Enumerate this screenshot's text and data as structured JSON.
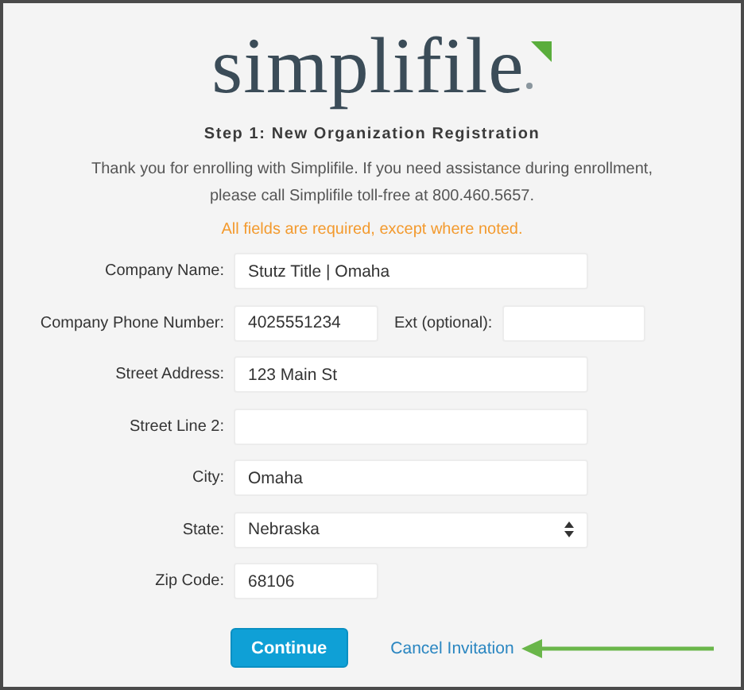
{
  "logo": {
    "text": "simplifile"
  },
  "heading": "Step 1: New Organization Registration",
  "intro": "Thank you for enrolling with Simplifile. If you need assistance during enrollment, please call Simplifile toll-free at 800.460.5657.",
  "notice": "All fields are required, except where noted.",
  "fields": [
    {
      "kind": "text",
      "label": "Company Name:",
      "value": "Stutz Title | Omaha"
    },
    {
      "kind": "short",
      "label": "Company Phone Number:",
      "value": "4025551234",
      "extra": {
        "label": "Ext (optional):"
      }
    },
    {
      "kind": "text",
      "label": "Street Address:",
      "value": "123 Main St"
    },
    {
      "kind": "text",
      "label": "Street Line 2:"
    },
    {
      "kind": "text",
      "label": "City:",
      "value": "Omaha"
    },
    {
      "kind": "select",
      "label": "State:",
      "value": "Nebraska"
    },
    {
      "kind": "short",
      "label": "Zip Code:",
      "value": "68106"
    }
  ],
  "actions": {
    "continue": "Continue",
    "cancel": "Cancel Invitation"
  }
}
